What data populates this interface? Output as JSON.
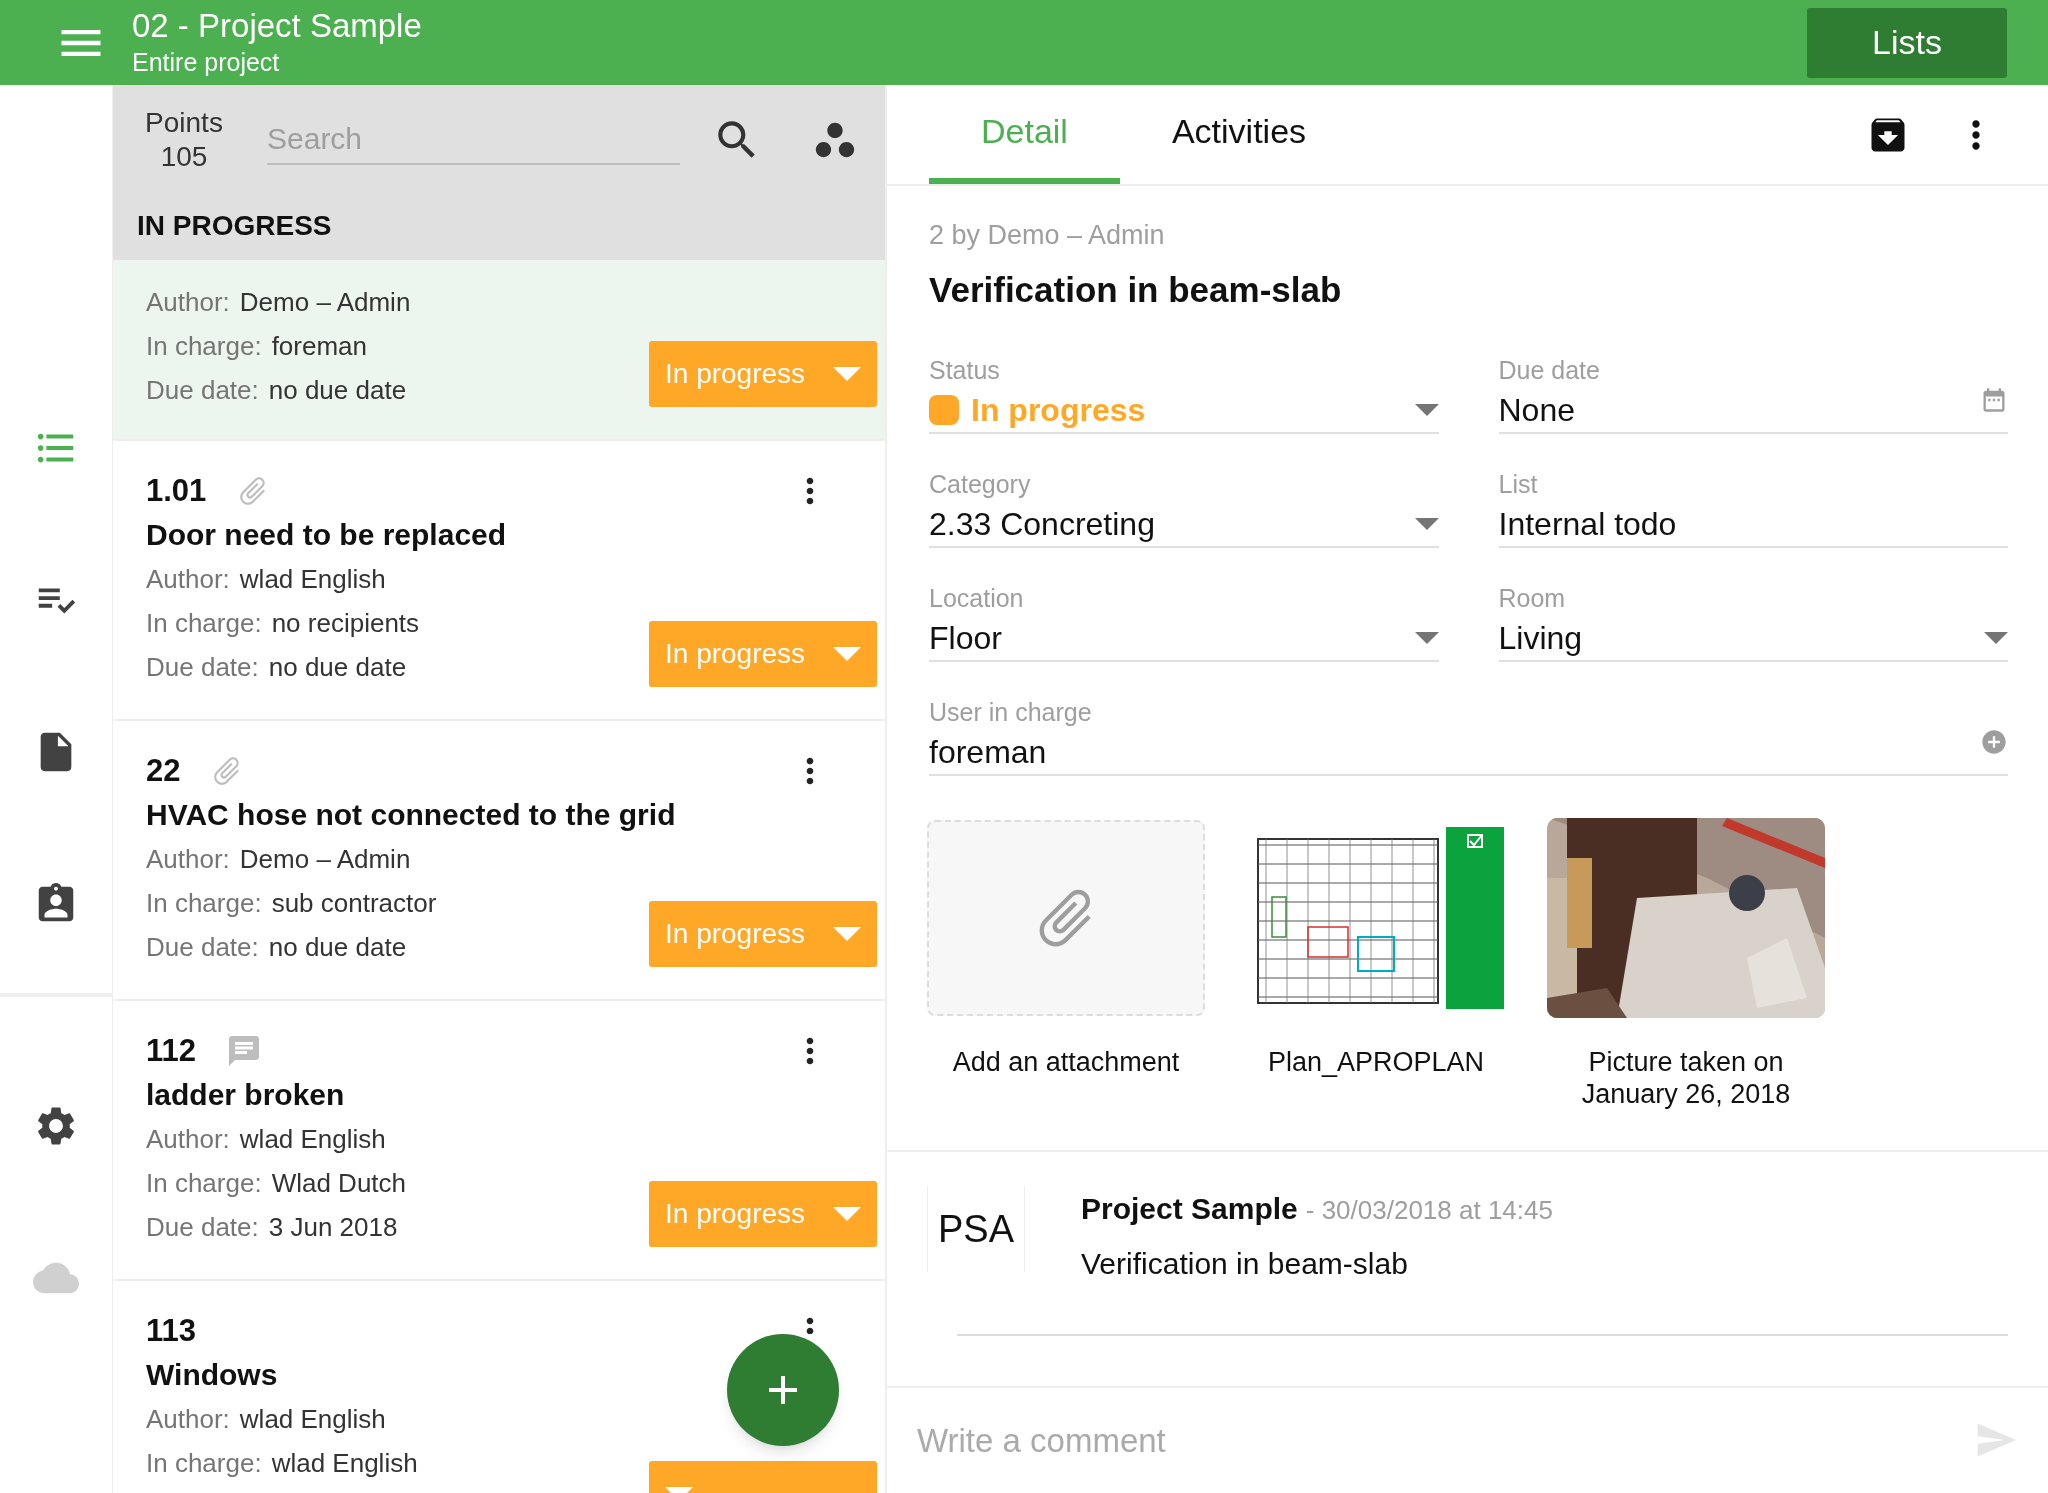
{
  "app_bar": {
    "title": "02 - Project Sample",
    "subtitle": "Entire project",
    "button": "Lists"
  },
  "nav": [
    {
      "kind": "list",
      "selected": true
    },
    {
      "kind": "checklist",
      "selected": false
    },
    {
      "kind": "document",
      "selected": false
    },
    {
      "kind": "contact",
      "selected": false
    },
    {
      "kind": "settings",
      "selected": false
    },
    {
      "kind": "cloud",
      "selected": false
    }
  ],
  "list": {
    "points_label": "Points",
    "points_count": "105",
    "search_placeholder": "Search",
    "section": "IN PROGRESS",
    "cards": [
      {
        "selected": true,
        "fields": [
          {
            "label": "Author:",
            "value": "Demo – Admin"
          },
          {
            "label": "In charge:",
            "value": "foreman"
          },
          {
            "label": "Due date:",
            "value": "no due date"
          }
        ],
        "status": "In progress"
      },
      {
        "number": "1.01",
        "kind": "attachment",
        "title": "Door need to be replaced",
        "selected": false,
        "fields": [
          {
            "label": "Author:",
            "value": "wlad English"
          },
          {
            "label": "In charge:",
            "value": "no recipients"
          },
          {
            "label": "Due date:",
            "value": "no due date"
          }
        ],
        "status": "In progress"
      },
      {
        "number": "22",
        "kind": "attachment",
        "title": "HVAC hose not connected to the grid",
        "selected": false,
        "fields": [
          {
            "label": "Author:",
            "value": "Demo – Admin"
          },
          {
            "label": "In charge:",
            "value": "sub contractor"
          },
          {
            "label": "Due date:",
            "value": "no due date"
          }
        ],
        "status": "In progress"
      },
      {
        "number": "112",
        "kind": "comment",
        "title": "ladder broken",
        "selected": false,
        "fields": [
          {
            "label": "Author:",
            "value": "wlad English"
          },
          {
            "label": "In charge:",
            "value": "Wlad Dutch"
          },
          {
            "label": "Due date:",
            "value": "3 Jun 2018"
          }
        ],
        "status": "In progress"
      },
      {
        "number": "113",
        "kind": "plain",
        "title": "Windows",
        "selected": false,
        "fields": [
          {
            "label": "Author:",
            "value": "wlad English"
          },
          {
            "label": "In charge:",
            "value": "wlad English"
          }
        ]
      }
    ]
  },
  "detail": {
    "tabs": [
      {
        "label": "Detail",
        "selected": true
      },
      {
        "label": "Activities",
        "selected": false
      }
    ],
    "meta": "2 by Demo – Admin",
    "title": "Verification in beam-slab",
    "fields": [
      {
        "kind": "status",
        "label": "Status",
        "value": "In progress"
      },
      {
        "kind": "date",
        "label": "Due date",
        "value": "None"
      },
      {
        "kind": "dropdown",
        "label": "Category",
        "value": "2.33 Concreting"
      },
      {
        "kind": "text",
        "label": "List",
        "value": "Internal todo"
      },
      {
        "kind": "dropdown",
        "label": "Location",
        "value": "Floor"
      },
      {
        "kind": "dropdown",
        "label": "Room",
        "value": "Living"
      },
      {
        "kind": "user",
        "label": "User in charge",
        "value": "foreman"
      }
    ],
    "attachments": [
      {
        "kind": "add",
        "label": "Add an attachment"
      },
      {
        "kind": "plan",
        "label": "Plan_APROPLAN"
      },
      {
        "label": "Picture taken on January 26, 2018"
      }
    ],
    "activity": {
      "avatar": "PSA",
      "author": "Project Sample",
      "date": "- 30/03/2018 at 14:45",
      "text": "Verification in beam-slab"
    },
    "comment_placeholder": "Write a comment"
  }
}
